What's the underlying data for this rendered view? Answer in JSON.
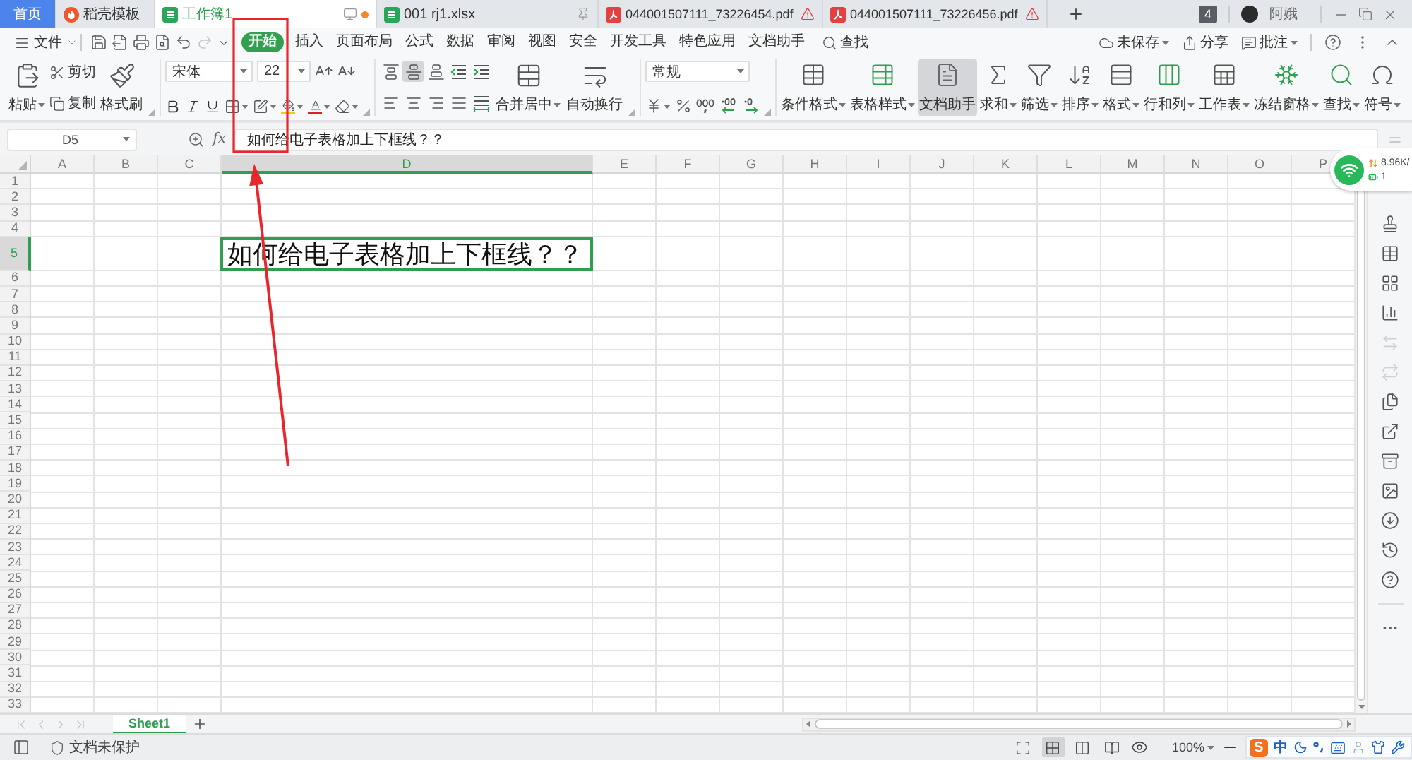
{
  "document_tabs": [
    {
      "label": "首页",
      "kind": "home",
      "selected": false
    },
    {
      "label": "稻壳模板",
      "kind": "docer",
      "selected": false
    },
    {
      "label": "工作簿1",
      "kind": "sheet",
      "selected": true,
      "unsaved": true,
      "pinned": false,
      "warning": false
    },
    {
      "label": "001 rj1.xlsx",
      "kind": "sheet",
      "selected": false,
      "unsaved": false,
      "pinned": true,
      "warning": false
    },
    {
      "label": "044001507111_73226454.pdf",
      "kind": "pdf",
      "selected": false,
      "unsaved": false,
      "pinned": false,
      "warning": true
    },
    {
      "label": "044001507111_73226456.pdf",
      "kind": "pdf",
      "selected": false,
      "unsaved": false,
      "pinned": false,
      "warning": true
    }
  ],
  "window_bar": {
    "badge": "4",
    "user": "阿娥"
  },
  "menu_bar": {
    "file": "文件",
    "quick_access": [
      {
        "kind": "save",
        "disabled": false
      },
      {
        "kind": "export",
        "disabled": false
      },
      {
        "kind": "print",
        "disabled": false
      },
      {
        "kind": "preview",
        "disabled": false
      },
      {
        "kind": "undo",
        "disabled": false
      },
      {
        "kind": "redo",
        "disabled": true
      },
      {
        "kind": "customize",
        "disabled": false
      }
    ],
    "ribbon_tabs": [
      {
        "label": "开始",
        "selected": true
      },
      {
        "label": "插入",
        "selected": false
      },
      {
        "label": "页面布局",
        "selected": false
      },
      {
        "label": "公式",
        "selected": false
      },
      {
        "label": "数据",
        "selected": false
      },
      {
        "label": "审阅",
        "selected": false
      },
      {
        "label": "视图",
        "selected": false
      },
      {
        "label": "安全",
        "selected": false
      },
      {
        "label": "开发工具",
        "selected": false
      },
      {
        "label": "特色应用",
        "selected": false
      },
      {
        "label": "文档助手",
        "selected": false
      }
    ],
    "search": "查找",
    "actions": [
      {
        "kind": "cloud",
        "label": "未保存",
        "dropdown": true
      },
      {
        "kind": "share",
        "label": "分享",
        "dropdown": false
      },
      {
        "kind": "comment",
        "label": "批注",
        "dropdown": true
      }
    ]
  },
  "ribbon": {
    "clipboard": {
      "paste": "粘贴",
      "cut": "剪切",
      "copy": "复制",
      "format_painter": "格式刷"
    },
    "font": {
      "name": "宋体",
      "size": "22"
    },
    "alignment": {
      "buttons": [
        {
          "kind": "top",
          "selected": false
        },
        {
          "kind": "middle",
          "selected": true
        },
        {
          "kind": "bottom",
          "selected": false
        },
        {
          "kind": "indent-decrease",
          "selected": false
        },
        {
          "kind": "indent-increase",
          "selected": false
        },
        {
          "kind": "left",
          "selected": false
        },
        {
          "kind": "center",
          "selected": false
        },
        {
          "kind": "right",
          "selected": false
        },
        {
          "kind": "justify",
          "selected": false
        },
        {
          "kind": "distributed",
          "selected": false
        }
      ],
      "merge": "合并居中",
      "wrap": "自动换行"
    },
    "number": {
      "format": "常规"
    },
    "tools": [
      {
        "kind": "conditional-format",
        "label": "条件格式",
        "dropdown": true,
        "selected": false
      },
      {
        "kind": "table-style",
        "label": "表格样式",
        "dropdown": true,
        "selected": false
      },
      {
        "kind": "assistant",
        "label": "文档助手",
        "dropdown": false,
        "selected": true
      },
      {
        "kind": "sum",
        "label": "求和",
        "dropdown": true,
        "selected": false
      },
      {
        "kind": "filter",
        "label": "筛选",
        "dropdown": true,
        "selected": false
      },
      {
        "kind": "sort",
        "label": "排序",
        "dropdown": true,
        "selected": false
      },
      {
        "kind": "format",
        "label": "格式",
        "dropdown": true,
        "selected": false
      },
      {
        "kind": "rows-columns",
        "label": "行和列",
        "dropdown": true,
        "selected": false
      },
      {
        "kind": "worksheet",
        "label": "工作表",
        "dropdown": true,
        "selected": false
      },
      {
        "kind": "freeze",
        "label": "冻结窗格",
        "dropdown": true,
        "selected": false
      },
      {
        "kind": "find",
        "label": "查找",
        "dropdown": true,
        "selected": false
      },
      {
        "kind": "symbol",
        "label": "符号",
        "dropdown": true,
        "selected": false
      }
    ]
  },
  "formula_bar": {
    "name_box": "D5",
    "function_label": "fx",
    "value": "如何给电子表格加上下框线？？"
  },
  "sheet": {
    "columns": [
      {
        "label": "A",
        "selected": false
      },
      {
        "label": "B",
        "selected": false
      },
      {
        "label": "C",
        "selected": false
      },
      {
        "label": "D",
        "selected": true,
        "wide": true
      },
      {
        "label": "E",
        "selected": false
      },
      {
        "label": "F",
        "selected": false
      },
      {
        "label": "G",
        "selected": false
      },
      {
        "label": "H",
        "selected": false
      },
      {
        "label": "I",
        "selected": false
      },
      {
        "label": "J",
        "selected": false
      },
      {
        "label": "K",
        "selected": false
      },
      {
        "label": "L",
        "selected": false
      },
      {
        "label": "M",
        "selected": false
      },
      {
        "label": "N",
        "selected": false
      },
      {
        "label": "O",
        "selected": false
      },
      {
        "label": "P",
        "selected": false
      }
    ],
    "rows": [
      {
        "label": "1",
        "selected": false
      },
      {
        "label": "2",
        "selected": false
      },
      {
        "label": "3",
        "selected": false
      },
      {
        "label": "4",
        "selected": false
      },
      {
        "label": "5",
        "selected": true
      },
      {
        "label": "6",
        "selected": false
      },
      {
        "label": "7",
        "selected": false
      },
      {
        "label": "8",
        "selected": false
      },
      {
        "label": "9",
        "selected": false
      },
      {
        "label": "10",
        "selected": false
      },
      {
        "label": "11",
        "selected": false
      },
      {
        "label": "12",
        "selected": false
      },
      {
        "label": "13",
        "selected": false
      },
      {
        "label": "14",
        "selected": false
      },
      {
        "label": "15",
        "selected": false
      },
      {
        "label": "16",
        "selected": false
      },
      {
        "label": "17",
        "selected": false
      },
      {
        "label": "18",
        "selected": false
      },
      {
        "label": "19",
        "selected": false
      },
      {
        "label": "20",
        "selected": false
      },
      {
        "label": "21",
        "selected": false
      },
      {
        "label": "22",
        "selected": false
      },
      {
        "label": "23",
        "selected": false
      },
      {
        "label": "24",
        "selected": false
      },
      {
        "label": "25",
        "selected": false
      },
      {
        "label": "26",
        "selected": false
      },
      {
        "label": "27",
        "selected": false
      },
      {
        "label": "28",
        "selected": false
      },
      {
        "label": "29",
        "selected": false
      },
      {
        "label": "30",
        "selected": false
      },
      {
        "label": "31",
        "selected": false
      },
      {
        "label": "32",
        "selected": false
      },
      {
        "label": "33",
        "selected": false
      }
    ],
    "active_cell": {
      "text": "如何给电子表格加上下框线？？"
    }
  },
  "sidebar": [
    {
      "kind": "stamp",
      "disabled": false
    },
    {
      "kind": "table",
      "disabled": false
    },
    {
      "kind": "apps",
      "disabled": false
    },
    {
      "kind": "chart",
      "disabled": false
    },
    {
      "kind": "swap",
      "disabled": true
    },
    {
      "kind": "transfer",
      "disabled": true
    },
    {
      "kind": "files",
      "disabled": false
    },
    {
      "kind": "export",
      "disabled": false
    },
    {
      "kind": "archive",
      "disabled": false
    },
    {
      "kind": "image",
      "disabled": false
    },
    {
      "kind": "download",
      "disabled": false
    },
    {
      "kind": "history",
      "disabled": false
    },
    {
      "kind": "help",
      "disabled": false
    },
    {
      "kind": "more",
      "disabled": false
    }
  ],
  "network_widget": {
    "speed": "8.96K/",
    "count": "1"
  },
  "sheet_bar": {
    "nav": [
      {
        "kind": "first",
        "disabled": true
      },
      {
        "kind": "previous",
        "disabled": true
      },
      {
        "kind": "next",
        "disabled": true
      },
      {
        "kind": "last",
        "disabled": true
      }
    ],
    "tabs": [
      {
        "label": "Sheet1",
        "selected": true
      }
    ]
  },
  "status_bar": {
    "protection": "文档未保护",
    "views": [
      {
        "kind": "fit",
        "selected": false
      },
      {
        "kind": "normal",
        "selected": true
      },
      {
        "kind": "page-break",
        "selected": false
      },
      {
        "kind": "reading",
        "selected": false
      }
    ],
    "zoom": "100%",
    "ime": {
      "logo": "S",
      "mode": "中"
    }
  }
}
